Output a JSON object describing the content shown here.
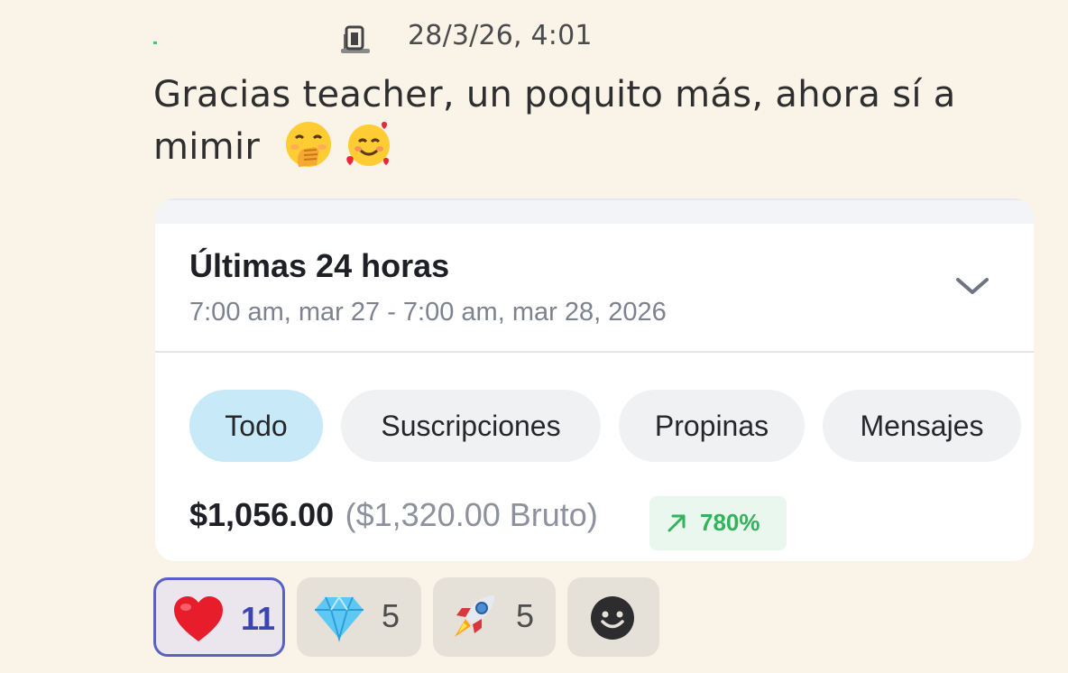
{
  "message": {
    "timestamp": "28/3/26, 4:01",
    "text_line1": "Gracias teacher, un poquito más, ahora sí a",
    "text_line2": "mimir",
    "emojis": [
      "face-with-hand-over-mouth",
      "smiling-face-with-hearts"
    ]
  },
  "earnings_card": {
    "period_title": "Últimas 24 horas",
    "period_range": "7:00 am, mar 27 - 7:00 am, mar 28, 2026",
    "filters": [
      {
        "label": "Todo",
        "active": true
      },
      {
        "label": "Suscripciones",
        "active": false
      },
      {
        "label": "Propinas",
        "active": false
      },
      {
        "label": "Mensajes",
        "active": false
      }
    ],
    "net_amount": "$1,056.00",
    "gross_amount": "($1,320.00 Bruto)",
    "trend_percent": "780%",
    "trend_direction": "up",
    "trend_color": "#33b35c",
    "active_chip_color": "#c8e9f8"
  },
  "reactions": [
    {
      "emoji": "red-heart",
      "count": "11",
      "selected": true
    },
    {
      "emoji": "gem-stone",
      "count": "5",
      "selected": false
    },
    {
      "emoji": "rocket",
      "count": "5",
      "selected": false
    },
    {
      "emoji": "add-reaction",
      "count": "",
      "selected": false
    }
  ],
  "colors": {
    "background": "#faf3e8",
    "selected_reaction_border": "#5b61c4"
  }
}
